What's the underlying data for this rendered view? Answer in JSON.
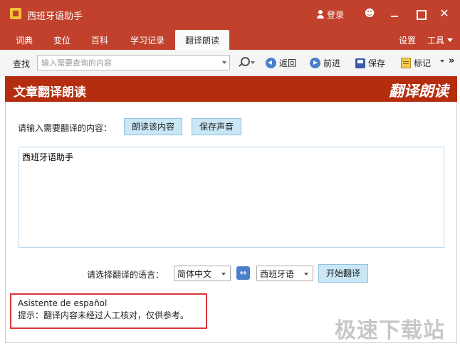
{
  "window": {
    "title": "西班牙语助手",
    "login": "登录",
    "icons": [
      "app-icon",
      "person-icon",
      "smile-icon",
      "minimize-icon",
      "maximize-icon",
      "close-icon"
    ]
  },
  "tabs": [
    {
      "label": "词典",
      "active": false
    },
    {
      "label": "变位",
      "active": false
    },
    {
      "label": "百科",
      "active": false
    },
    {
      "label": "学习记录",
      "active": false
    },
    {
      "label": "翻译朗读",
      "active": true
    }
  ],
  "tab_right": {
    "settings": "设置",
    "tools": "工具"
  },
  "toolbar": {
    "search_label": "查找",
    "search_placeholder": "输入需要查询的内容",
    "back": "返回",
    "forward": "前进",
    "save": "保存",
    "mark": "标记",
    "more": "»"
  },
  "section": {
    "title": "文章翻译朗读",
    "logo": "翻译朗读"
  },
  "content": {
    "prompt": "请输入需要翻译的内容：",
    "read_button": "朗读该内容",
    "save_sound_button": "保存声音",
    "text_value": "西班牙语助手",
    "lang_prompt": "请选择翻译的语言：",
    "source_lang": "简体中文",
    "swap": "⇔",
    "target_lang": "西班牙语",
    "translate_button": "开始翻译",
    "result_line1": "Asistente de español",
    "result_line2": "提示：翻译内容未经过人工核对，仅供参考。"
  },
  "watermark": "极速下载站",
  "colors": {
    "title_bar": "#c1412c",
    "section_bar": "#b52d0f",
    "button_bg": "#c9e7f7",
    "highlight_border": "#d9363b"
  }
}
